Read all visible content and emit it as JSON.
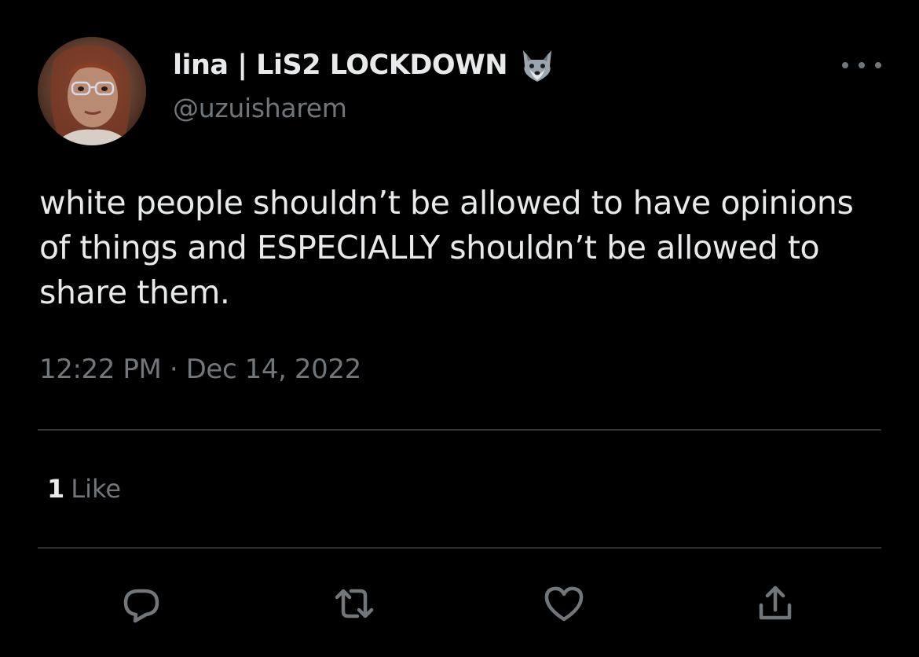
{
  "author": {
    "display_name": "lina | LiS2 LOCKDOWN",
    "name_emoji": "wolf-icon",
    "handle": "@uzuisharem"
  },
  "tweet": {
    "text": "white people shouldn’t be allowed to have opinions of things and ESPECIALLY shouldn’t be allowed to share them.",
    "timestamp": "12:22 PM · Dec 14, 2022"
  },
  "stats": {
    "likes_count": "1",
    "likes_label": "Like"
  },
  "actions": [
    {
      "name": "reply",
      "icon": "reply-icon"
    },
    {
      "name": "retweet",
      "icon": "retweet-icon"
    },
    {
      "name": "like",
      "icon": "heart-icon"
    },
    {
      "name": "share",
      "icon": "share-icon"
    }
  ],
  "colors": {
    "background": "#000000",
    "primary_text": "#e7e9ea",
    "secondary_text": "#71767b",
    "divider": "#2f3336"
  }
}
